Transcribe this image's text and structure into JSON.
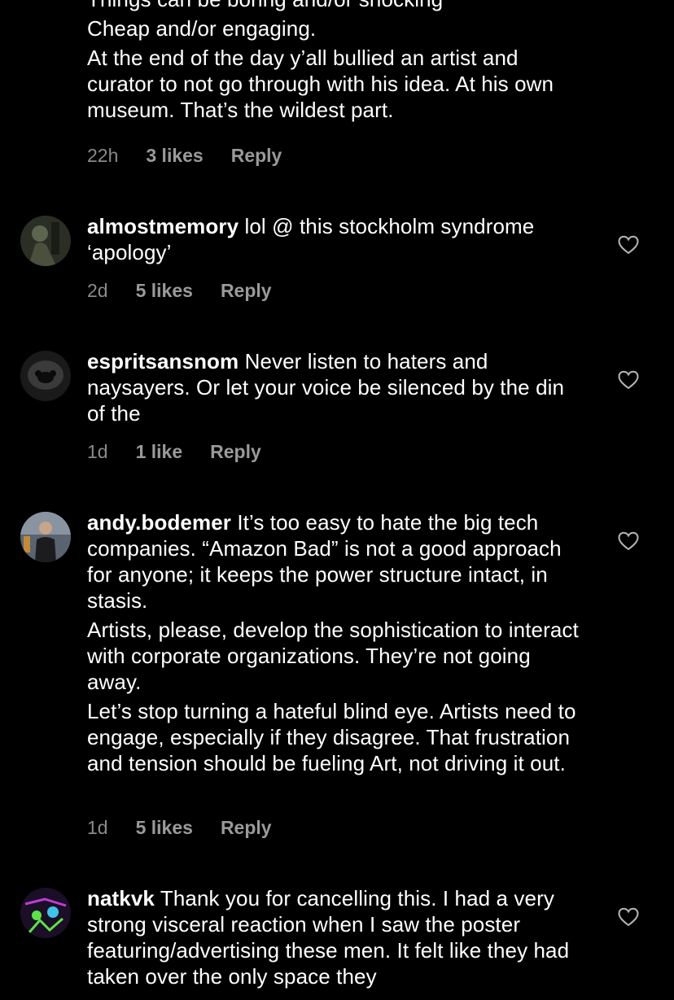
{
  "comments": [
    {
      "paragraphs": [
        "Things can be boring and/or shocking",
        "Cheap and/or engaging.",
        "At the end of the day y’all bullied an artist and curator to not go through with his idea. At his own museum. That’s the wildest part."
      ],
      "time": "22h",
      "likes": "3 likes",
      "reply": "Reply"
    },
    {
      "username": "almostmemory",
      "text": "lol @ this stockholm syndrome ‘apology’",
      "time": "2d",
      "likes": "5 likes",
      "reply": "Reply",
      "avatar_icon": "user-avatar-photo"
    },
    {
      "username": "espritsansnom",
      "text": "Never listen to haters and naysayers. Or let your voice be silenced by the din of the",
      "time": "1d",
      "likes": "1 like",
      "reply": "Reply",
      "avatar_icon": "user-avatar-photo"
    },
    {
      "username": "andy.bodemer",
      "text": "It’s too easy to hate the big tech companies. “Amazon Bad” is not a good approach for anyone; it keeps the power structure intact, in stasis.",
      "paragraphs": [
        "Artists, please, develop the sophistication to interact with corporate organizations. They’re not going away.",
        "Let’s stop turning a hateful blind eye. Artists need to engage, especially if they disagree. That frustration and tension should be fueling Art, not driving it out."
      ],
      "time": "1d",
      "likes": "5 likes",
      "reply": "Reply",
      "avatar_icon": "user-avatar-photo"
    },
    {
      "username": "natkvk",
      "text": "Thank you for cancelling this. I had a very strong visceral reaction when I saw the poster featuring/advertising these men. It felt like they had taken over the only space they",
      "avatar_icon": "user-avatar-photo"
    }
  ],
  "colors": {
    "background": "#000000",
    "text": "#ffffff",
    "meta": "#9a9a9a"
  },
  "icons": {
    "like": "heart-outline-icon"
  }
}
